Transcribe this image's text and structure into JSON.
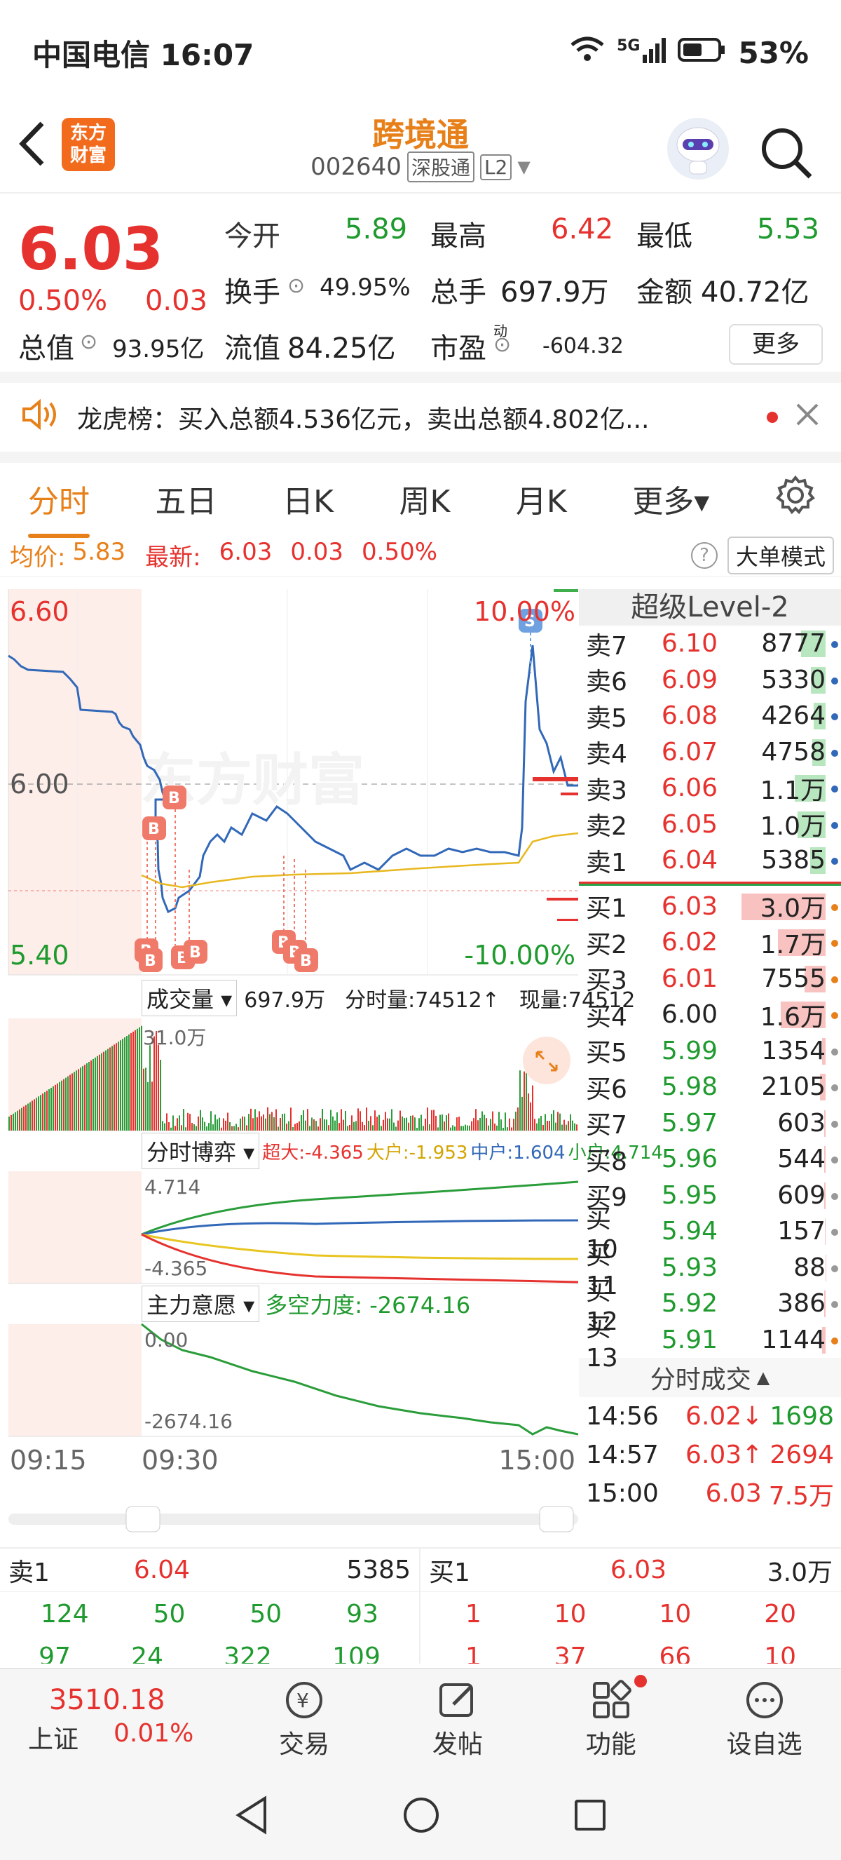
{
  "status": {
    "carrier_time": "中国电信 16:07",
    "network": "5G",
    "battery": "53%"
  },
  "header": {
    "logo_line1": "东方",
    "logo_line2": "财富",
    "title": "跨境通",
    "code": "002640",
    "tag": "深股通",
    "level": "L2"
  },
  "quote": {
    "price": "6.03",
    "change_pct": "0.50%",
    "change": "0.03",
    "open_label": "今开",
    "open": "5.89",
    "high_label": "最高",
    "high": "6.42",
    "low_label": "最低",
    "low": "5.53",
    "turnover_label": "换手",
    "turnover": "49.95%",
    "volume_label": "总手",
    "volume": "697.9万",
    "amount_label": "金额",
    "amount": "40.72亿",
    "total_mv_label": "总值",
    "total_mv": "93.95亿",
    "float_mv_label": "流值",
    "float_mv": "84.25亿",
    "pe_label": "市盈",
    "pe_sup": "动",
    "pe": "-604.32",
    "more": "更多"
  },
  "notice": {
    "text": "龙虎榜：买入总额4.536亿元，卖出总额4.802亿..."
  },
  "tabs": [
    "分时",
    "五日",
    "日K",
    "周K",
    "月K",
    "更多▾"
  ],
  "avgline": {
    "avg_label": "均价:",
    "avg": "5.83",
    "latest_label": "最新:",
    "latest": "6.03",
    "chg": "0.03",
    "pct": "0.50%",
    "big_order_mode": "大单模式"
  },
  "chart": {
    "price_top": "6.60",
    "price_mid": "6.00",
    "price_bot": "5.40",
    "pct_top": "10.00%",
    "pct_bot": "-10.00%",
    "vol_btn": "成交量 ▾",
    "vol_total": "697.9万",
    "vol_min": "分时量:74512↑",
    "vol_now": "现量:74512",
    "vol_max": "31.0万",
    "game_btn": "分时博弈 ▾",
    "game_super": "超大:-4.365",
    "game_big": "大户:-1.953",
    "game_mid": "中户:1.604",
    "game_small": "小户:4.714",
    "game_top": "4.714",
    "game_bot": "-4.365",
    "will_btn": "主力意愿 ▾",
    "will_label": "多空力度: -2674.16",
    "will_top": "0.00",
    "will_bot": "-2674.16",
    "time_start": "09:15",
    "time_open": "09:30",
    "time_end": "15:00",
    "watermark": "东方财富"
  },
  "book": {
    "title": "超级Level-2",
    "asks": [
      {
        "name": "卖7",
        "price": "6.10",
        "vol": "8777"
      },
      {
        "name": "卖6",
        "price": "6.09",
        "vol": "5330"
      },
      {
        "name": "卖5",
        "price": "6.08",
        "vol": "4264"
      },
      {
        "name": "卖4",
        "price": "6.07",
        "vol": "4758"
      },
      {
        "name": "卖3",
        "price": "6.06",
        "vol": "1.1万"
      },
      {
        "name": "卖2",
        "price": "6.05",
        "vol": "1.0万"
      },
      {
        "name": "卖1",
        "price": "6.04",
        "vol": "5385"
      }
    ],
    "bids": [
      {
        "name": "买1",
        "price": "6.03",
        "vol": "3.0万"
      },
      {
        "name": "买2",
        "price": "6.02",
        "vol": "1.7万"
      },
      {
        "name": "买3",
        "price": "6.01",
        "vol": "7555"
      },
      {
        "name": "买4",
        "price": "6.00",
        "vol": "1.6万"
      },
      {
        "name": "买5",
        "price": "5.99",
        "vol": "1354"
      },
      {
        "name": "买6",
        "price": "5.98",
        "vol": "2105"
      },
      {
        "name": "买7",
        "price": "5.97",
        "vol": "603"
      },
      {
        "name": "买8",
        "price": "5.96",
        "vol": "544"
      },
      {
        "name": "买9",
        "price": "5.95",
        "vol": "609"
      },
      {
        "name": "买10",
        "price": "5.94",
        "vol": "157"
      },
      {
        "name": "买11",
        "price": "5.93",
        "vol": "88"
      },
      {
        "name": "买12",
        "price": "5.92",
        "vol": "386"
      },
      {
        "name": "买13",
        "price": "5.91",
        "vol": "1144"
      }
    ],
    "trades_title": "分时成交",
    "trades": [
      {
        "time": "14:56",
        "price": "6.02↓",
        "vol": "1698"
      },
      {
        "time": "14:57",
        "price": "6.03↑",
        "vol": "2694"
      },
      {
        "time": "15:00",
        "price": "6.03",
        "vol": "7.5万"
      }
    ]
  },
  "level2": {
    "sell_label": "卖1",
    "sell_price": "6.04",
    "sell_vol": "5385",
    "buy_label": "买1",
    "buy_price": "6.03",
    "buy_vol": "3.0万",
    "sell_q1": [
      "124",
      "50",
      "50",
      "93"
    ],
    "buy_q1": [
      "1",
      "10",
      "10",
      "20"
    ],
    "sell_q2": [
      "97",
      "24",
      "322",
      "109"
    ],
    "buy_q2": [
      "1",
      "37",
      "66",
      "10"
    ]
  },
  "nav": {
    "index_value": "3510.18",
    "index_name": "上证",
    "index_pct": "0.01%",
    "trade": "交易",
    "post": "发帖",
    "func": "功能",
    "watch": "设自选"
  }
}
